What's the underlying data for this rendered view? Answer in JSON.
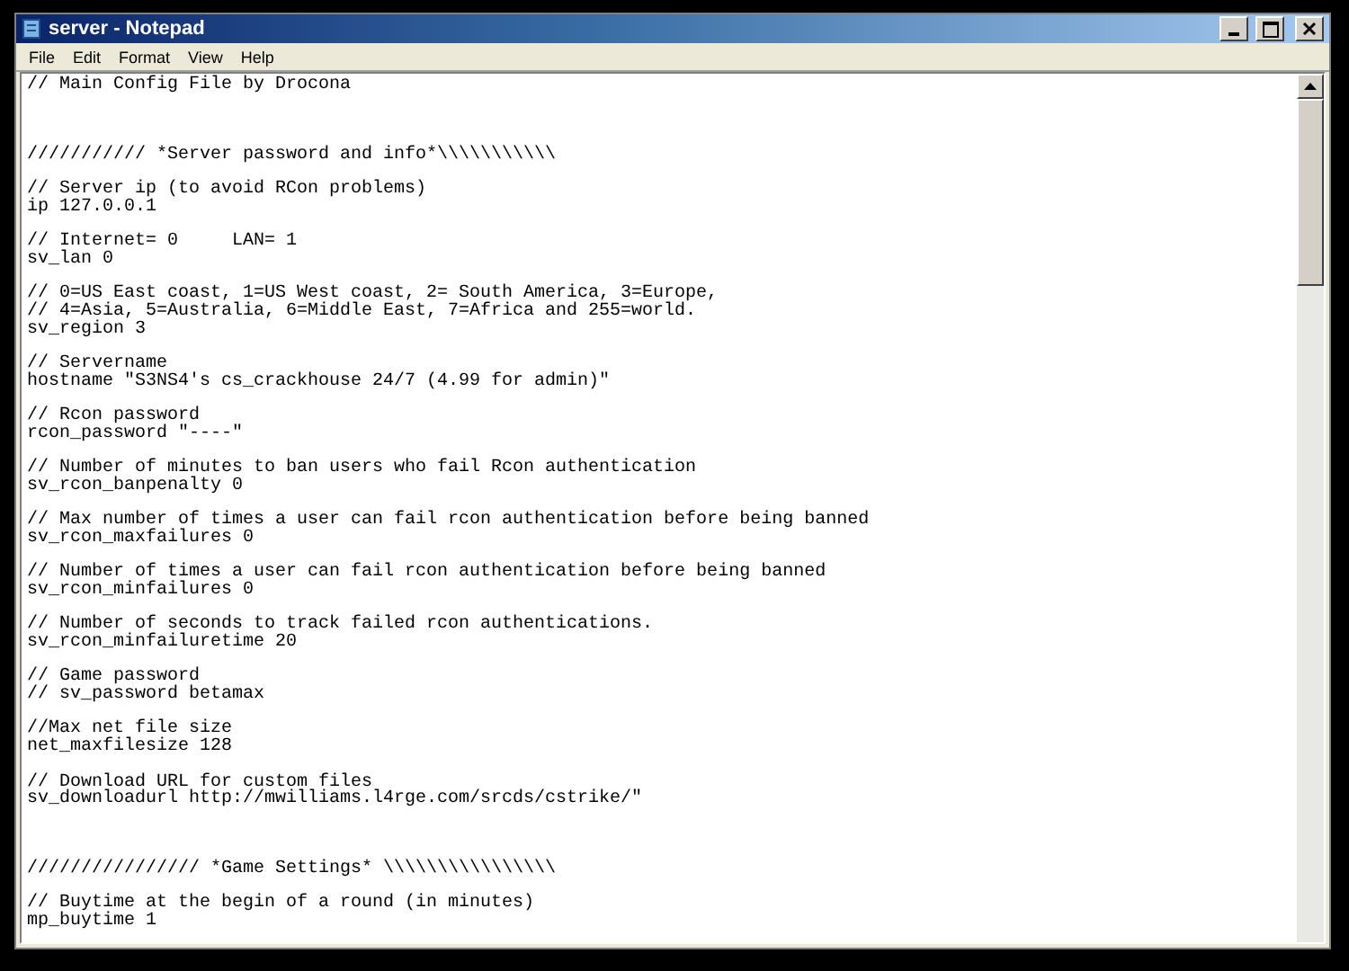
{
  "window": {
    "title": "server - Notepad"
  },
  "menu": [
    "File",
    "Edit",
    "Format",
    "View",
    "Help"
  ],
  "lines": [
    {
      "kind": "text",
      "text": "// Main Config File by Drocona"
    },
    {
      "kind": "blank"
    },
    {
      "kind": "blank"
    },
    {
      "kind": "blank"
    },
    {
      "kind": "text",
      "text": "/////////// *Server password and info*\\\\\\\\\\\\\\\\\\\\\\"
    },
    {
      "kind": "blank"
    },
    {
      "kind": "text",
      "text": "// Server ip (to avoid RCon problems)"
    },
    {
      "kind": "text",
      "text": "ip 127.0.0.1"
    },
    {
      "kind": "blank"
    },
    {
      "kind": "text",
      "text": "// Internet= 0     LAN= 1"
    },
    {
      "kind": "text",
      "text": "sv_lan 0"
    },
    {
      "kind": "blank"
    },
    {
      "kind": "text",
      "text": "// 0=US East coast, 1=US West coast, 2= South America, 3=Europe,"
    },
    {
      "kind": "text",
      "text": "// 4=Asia, 5=Australia, 6=Middle East, 7=Africa and 255=world."
    },
    {
      "kind": "text",
      "text": "sv_region 3"
    },
    {
      "kind": "blank"
    },
    {
      "kind": "text",
      "text": "// Servername"
    },
    {
      "kind": "text",
      "text": "hostname \"S3NS4's cs_crackhouse 24/7 (4.99 for admin)\""
    },
    {
      "kind": "blank"
    },
    {
      "kind": "text",
      "text": "// Rcon password"
    },
    {
      "kind": "text",
      "text": "rcon_password \"----\""
    },
    {
      "kind": "blank"
    },
    {
      "kind": "text",
      "text": "// Number of minutes to ban users who fail Rcon authentication"
    },
    {
      "kind": "text",
      "text": "sv_rcon_banpenalty 0"
    },
    {
      "kind": "blank"
    },
    {
      "kind": "text",
      "text": "// Max number of times a user can fail rcon authentication before being banned"
    },
    {
      "kind": "text",
      "text": "sv_rcon_maxfailures 0"
    },
    {
      "kind": "blank"
    },
    {
      "kind": "text",
      "text": "// Number of times a user can fail rcon authentication before being banned"
    },
    {
      "kind": "text",
      "text": "sv_rcon_minfailures 0"
    },
    {
      "kind": "blank"
    },
    {
      "kind": "text",
      "text": "// Number of seconds to track failed rcon authentications."
    },
    {
      "kind": "text",
      "text": "sv_rcon_minfailuretime 20"
    },
    {
      "kind": "blank"
    },
    {
      "kind": "text",
      "text": "// Game password"
    },
    {
      "kind": "text",
      "text": "// sv_password betamax"
    },
    {
      "kind": "blank"
    },
    {
      "kind": "text",
      "text": "//Max net file size"
    },
    {
      "kind": "text",
      "text": "net_maxfilesize 128"
    },
    {
      "kind": "blank"
    },
    {
      "kind": "text",
      "text": "// Download URL for custom files"
    },
    {
      "kind": "text",
      "text": "sv_downloadurl http://mwilliams.l4rge.com/srcds/cstrike/\""
    },
    {
      "kind": "blank"
    },
    {
      "kind": "blank"
    },
    {
      "kind": "blank"
    },
    {
      "kind": "text",
      "text": "//////////////// *Game Settings* \\\\\\\\\\\\\\\\\\\\\\\\\\\\\\\\"
    },
    {
      "kind": "blank"
    },
    {
      "kind": "text",
      "text": "// Buytime at the begin of a round (in minutes)"
    },
    {
      "kind": "text",
      "text": "mp_buytime 1"
    }
  ]
}
